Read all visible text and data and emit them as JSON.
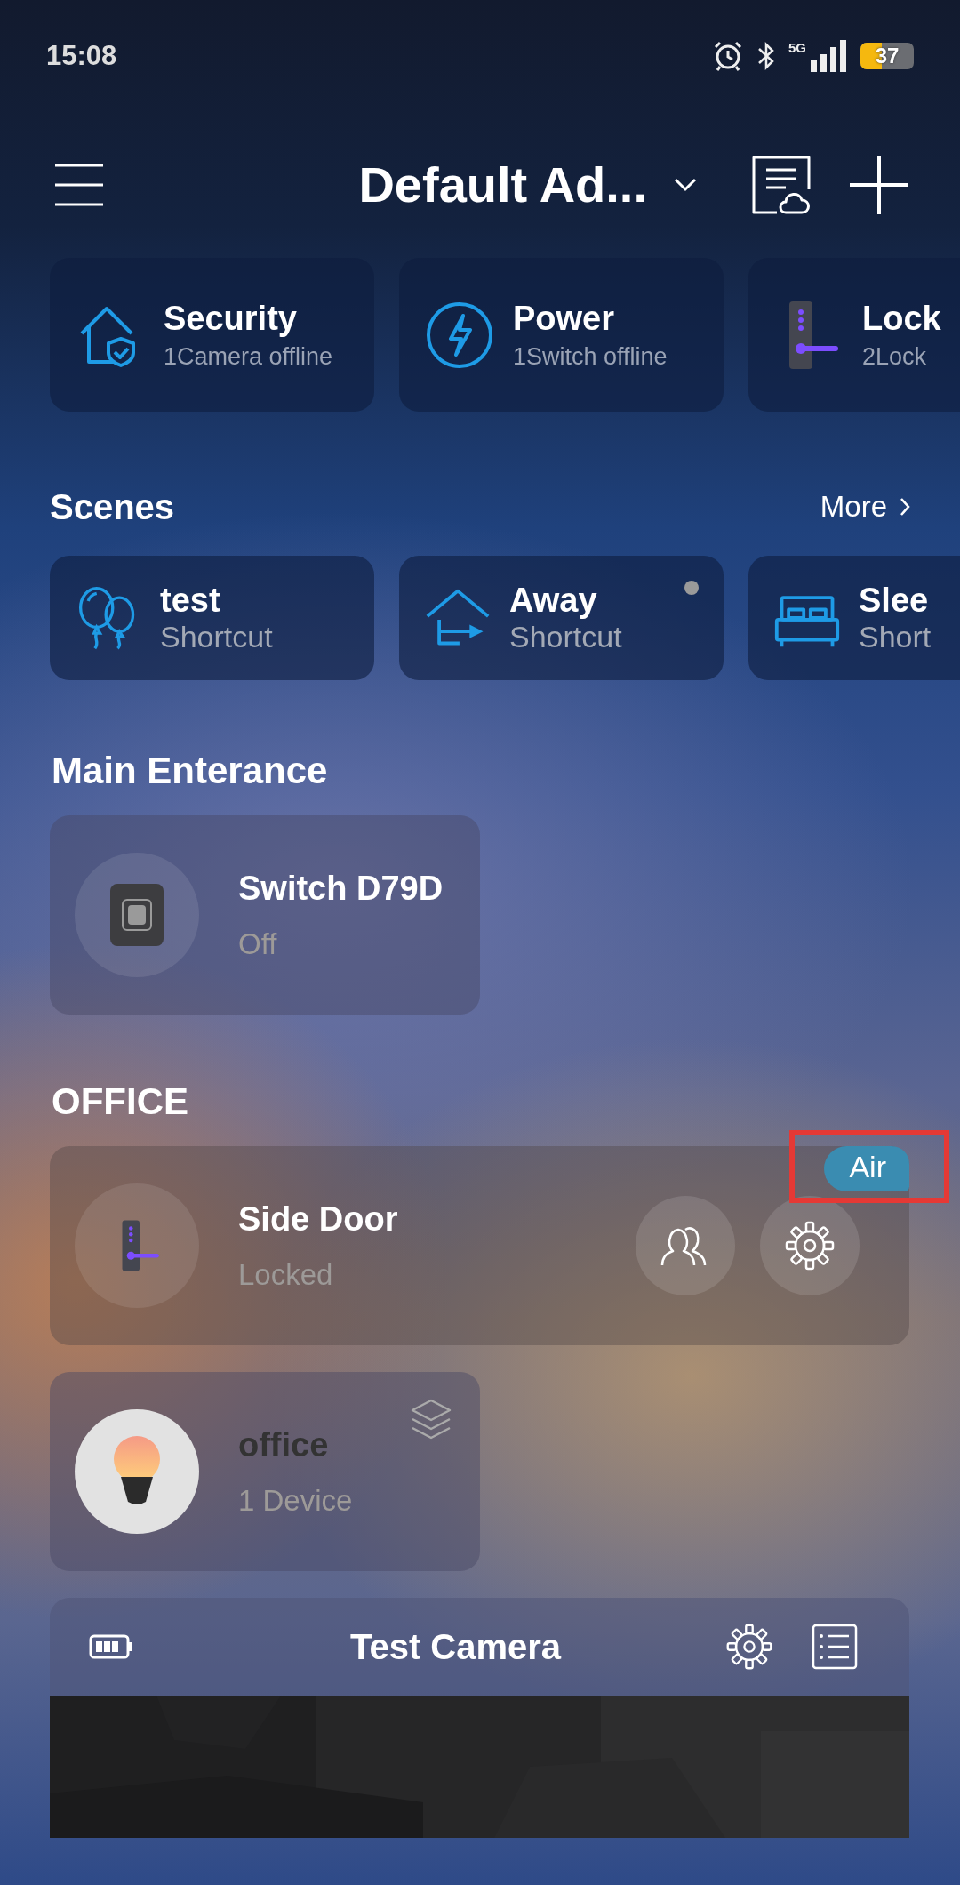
{
  "status_bar": {
    "time": "15:08",
    "network": "5G",
    "battery": "37"
  },
  "header": {
    "title": "Default Ad..."
  },
  "summary": [
    {
      "kind": "security",
      "title": "Security",
      "subtitle": "1Camera offline"
    },
    {
      "kind": "power",
      "title": "Power",
      "subtitle": "1Switch offline"
    },
    {
      "kind": "lock",
      "title": "Lock",
      "subtitle": "2Lock"
    }
  ],
  "scenes": {
    "title": "Scenes",
    "more": "More",
    "items": [
      {
        "kind": "balloons",
        "name": "test",
        "subtitle": "Shortcut",
        "dot": false
      },
      {
        "kind": "away",
        "name": "Away",
        "subtitle": "Shortcut",
        "dot": true
      },
      {
        "kind": "bed",
        "name": "Slee",
        "subtitle": "Short",
        "dot": false
      }
    ]
  },
  "rooms": [
    {
      "title": "Main Enterance",
      "devices": [
        {
          "kind": "switch",
          "name": "Switch D79D",
          "status": "Off"
        }
      ]
    },
    {
      "title": "OFFICE",
      "devices": [
        {
          "kind": "lock",
          "name": "Side Door",
          "status": "Locked",
          "actions": [
            {
              "kind": "users"
            },
            {
              "kind": "settings"
            }
          ],
          "badge": {
            "label": "Air",
            "highlighted": true
          }
        },
        {
          "kind": "group",
          "name": "office",
          "status": "1 Device"
        }
      ]
    }
  ],
  "camera": {
    "name": "Test Camera"
  }
}
